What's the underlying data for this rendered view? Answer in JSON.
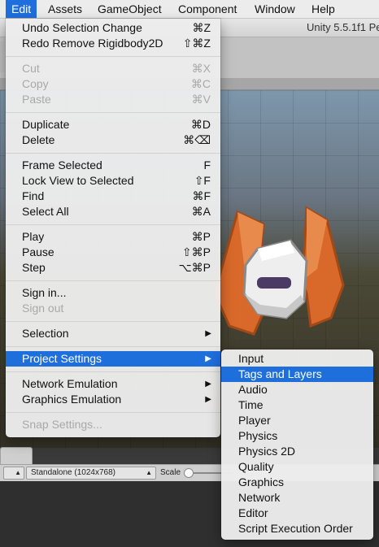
{
  "menubar": {
    "items": [
      "Edit",
      "Assets",
      "GameObject",
      "Component",
      "Window",
      "Help"
    ],
    "active": "Edit"
  },
  "window": {
    "version_label": "Unity 5.5.1f1 Pe"
  },
  "game_toolbar": {
    "display_value": "Standalone (1024x768)",
    "scale_label": "Scale"
  },
  "edit_menu": {
    "undo": {
      "label": "Undo Selection Change",
      "shortcut": "⌘Z"
    },
    "redo": {
      "label": "Redo Remove Rigidbody2D",
      "shortcut": "⇧⌘Z"
    },
    "cut": {
      "label": "Cut",
      "shortcut": "⌘X"
    },
    "copy": {
      "label": "Copy",
      "shortcut": "⌘C"
    },
    "paste": {
      "label": "Paste",
      "shortcut": "⌘V"
    },
    "duplicate": {
      "label": "Duplicate",
      "shortcut": "⌘D"
    },
    "delete": {
      "label": "Delete",
      "shortcut": "⌘⌫"
    },
    "frame_selected": {
      "label": "Frame Selected",
      "shortcut": "F"
    },
    "lock_view": {
      "label": "Lock View to Selected",
      "shortcut": "⇧F"
    },
    "find": {
      "label": "Find",
      "shortcut": "⌘F"
    },
    "select_all": {
      "label": "Select All",
      "shortcut": "⌘A"
    },
    "play": {
      "label": "Play",
      "shortcut": "⌘P"
    },
    "pause": {
      "label": "Pause",
      "shortcut": "⇧⌘P"
    },
    "step": {
      "label": "Step",
      "shortcut": "⌥⌘P"
    },
    "sign_in": {
      "label": "Sign in..."
    },
    "sign_out": {
      "label": "Sign out"
    },
    "selection": {
      "label": "Selection"
    },
    "project_settings": {
      "label": "Project Settings"
    },
    "network_emulation": {
      "label": "Network Emulation"
    },
    "graphics_emulation": {
      "label": "Graphics Emulation"
    },
    "snap_settings": {
      "label": "Snap Settings..."
    }
  },
  "project_settings_menu": {
    "items": [
      "Input",
      "Tags and Layers",
      "Audio",
      "Time",
      "Player",
      "Physics",
      "Physics 2D",
      "Quality",
      "Graphics",
      "Network",
      "Editor",
      "Script Execution Order"
    ],
    "highlighted": "Tags and Layers"
  },
  "colors": {
    "selection": "#1e6fdc",
    "menu_background": "#ececec",
    "ship_orange": "#d9692a"
  },
  "icons": {
    "submenu_arrow": "▶"
  }
}
